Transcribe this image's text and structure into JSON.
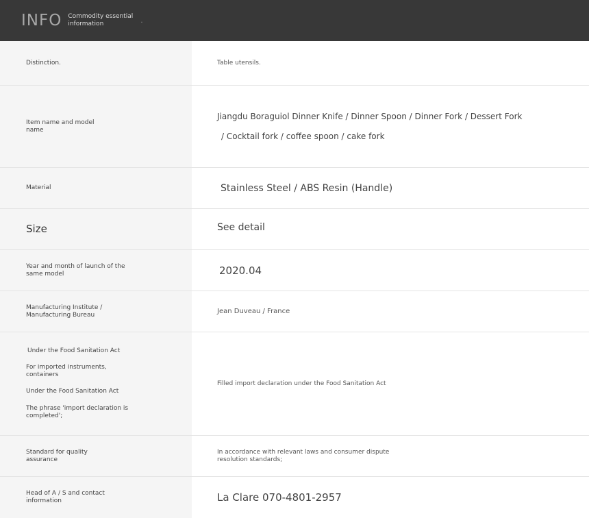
{
  "header": {
    "title": "INFO",
    "subtitle_line1": "Commodity essential",
    "subtitle_line2": "information",
    "tail": "."
  },
  "rows": [
    {
      "label": "Distinction.",
      "value": "Table utensils."
    },
    {
      "label_line1": "Item name and model",
      "label_line2": "name",
      "value_line1": "Jiangdu Boraguiol Dinner Knife / Dinner Spoon / Dinner Fork / Dessert Fork",
      "value_line2": "/ Cocktail fork / coffee spoon / cake fork"
    },
    {
      "label": "Material",
      "value": "Stainless Steel / ABS Resin (Handle)"
    },
    {
      "label": "Size",
      "value": "See detail"
    },
    {
      "label_line1": "Year and month of launch of the",
      "label_line2": "same model",
      "value": "2020.04"
    },
    {
      "label_line1": "Manufacturing Institute /",
      "label_line2": "Manufacturing Bureau",
      "value": "Jean Duveau / France"
    },
    {
      "label_items": [
        "Under the Food Sanitation Act",
        "For imported instruments, containers",
        "Under the Food Sanitation Act",
        "The phrase 'import declaration is completed';"
      ],
      "value": "Filled import declaration under the Food Sanitation Act"
    },
    {
      "label_line1": "Standard for quality",
      "label_line2": "assurance",
      "value_line1": "In accordance with relevant laws and consumer dispute",
      "value_line2": "resolution standards;"
    },
    {
      "label_line1": "Head of A / S and contact",
      "label_line2": "information",
      "value": "La Clare 070-4801-2957"
    }
  ]
}
